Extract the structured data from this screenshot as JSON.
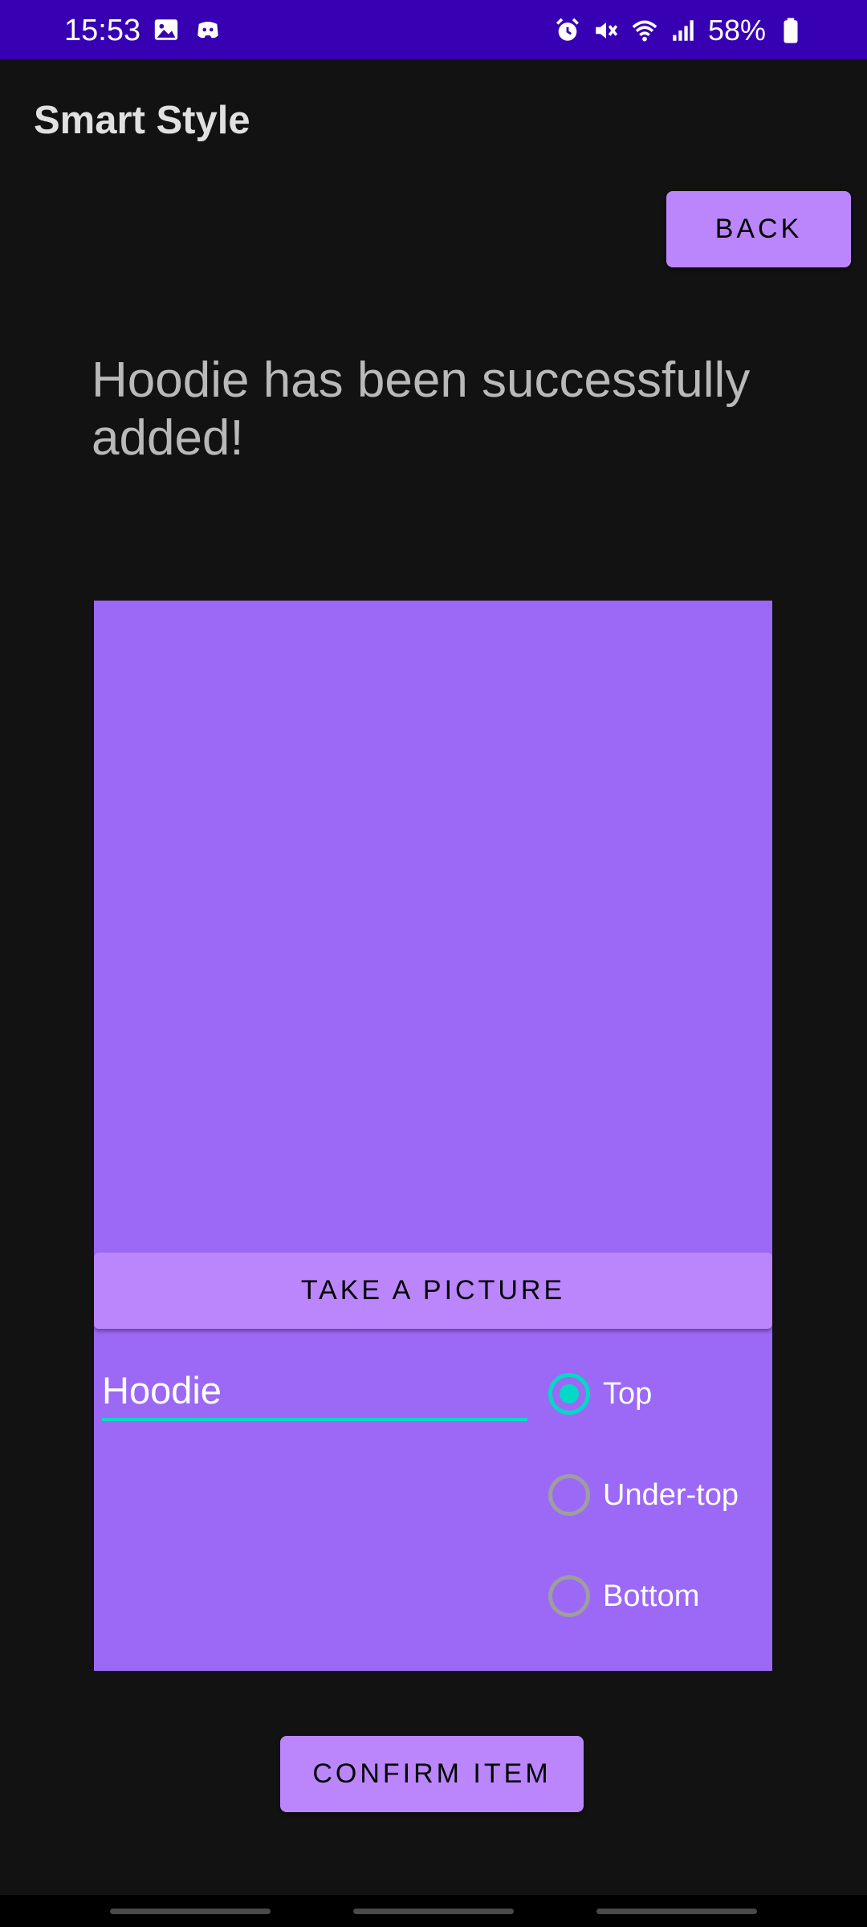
{
  "status_bar": {
    "time": "15:53",
    "battery": "58%",
    "background_color": "#3700b3",
    "left_icons": [
      "image-icon",
      "discord-icon"
    ],
    "right_icons": [
      "alarm-icon",
      "mute-icon",
      "wifi-icon",
      "signal-icon",
      "battery-icon"
    ]
  },
  "app_bar": {
    "title": "Smart Style"
  },
  "back_button": {
    "label": "BACK"
  },
  "message": {
    "text": "Hoodie has been successfully added!"
  },
  "item_card": {
    "background_color": "#9b69f5",
    "take_picture_label": "TAKE A PICTURE",
    "name_field": {
      "value": "Hoodie",
      "underline_color": "#03dac5"
    },
    "category_options": [
      {
        "label": "Top",
        "checked": true
      },
      {
        "label": "Under-top",
        "checked": false
      },
      {
        "label": "Bottom",
        "checked": false
      }
    ]
  },
  "confirm_button": {
    "label": "CONFIRM ITEM"
  },
  "colors": {
    "accent": "#bb86fc",
    "secondary": "#03dac5",
    "background": "#121212"
  }
}
